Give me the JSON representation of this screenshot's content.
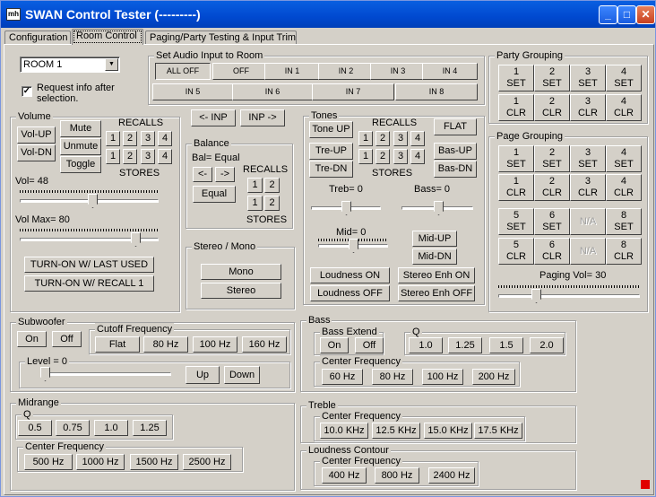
{
  "window": {
    "title": "SWAN Control Tester (---------)",
    "icon": "mh",
    "min": "_",
    "max": "□",
    "close": "✕"
  },
  "tabs": [
    "Configuration",
    "Room Control",
    "Paging/Party Testing & Input Trim"
  ],
  "room": {
    "selected": "ROOM 1",
    "request_info": "Request info after\nselection.",
    "checked": "✓"
  },
  "audio_input": {
    "title": "Set Audio Input to Room",
    "row1": [
      "ALL OFF",
      "OFF",
      "IN 1",
      "IN 2",
      "IN 3",
      "IN 4"
    ],
    "row2": [
      "IN 5",
      "IN 6",
      "IN 7",
      "IN 8"
    ]
  },
  "volume": {
    "title": "Volume",
    "vol_up": "Vol-UP",
    "vol_dn": "Vol-DN",
    "mute": "Mute",
    "unmute": "Unmute",
    "toggle": "Toggle",
    "recalls": "RECALLS",
    "stores": "STORES",
    "r1": [
      "1",
      "2",
      "3",
      "4"
    ],
    "r2": [
      "1",
      "2",
      "3",
      "4"
    ],
    "vol_label": "Vol= 48",
    "vol_value": 48,
    "volmax_label": "Vol Max= 80",
    "volmax_value": 80,
    "turn_on_last": "TURN-ON W/ LAST USED",
    "turn_on_recall": "TURN-ON W/ RECALL 1"
  },
  "inp": {
    "prev": "<- INP",
    "next": "INP ->"
  },
  "balance": {
    "title": "Balance",
    "status": "Bal= Equal",
    "left": "<-",
    "right": "->",
    "equal": "Equal",
    "recalls": "RECALLS",
    "stores": "STORES",
    "r1": [
      "1",
      "2"
    ],
    "r2": [
      "1",
      "2"
    ]
  },
  "stereo_mono": {
    "title": "Stereo / Mono",
    "mono": "Mono",
    "stereo": "Stereo"
  },
  "tones": {
    "title": "Tones",
    "tone_up": "Tone UP",
    "recalls": "RECALLS",
    "flat": "FLAT",
    "tre_up": "Tre-UP",
    "tre_dn": "Tre-DN",
    "bas_up": "Bas-UP",
    "bas_dn": "Bas-DN",
    "r1": [
      "1",
      "2",
      "3",
      "4"
    ],
    "r2": [
      "1",
      "2",
      "3",
      "4"
    ],
    "stores": "STORES",
    "treb_label": "Treb= 0",
    "bass_label": "Bass= 0",
    "mid_label": "Mid= 0",
    "mid_up": "Mid-UP",
    "mid_dn": "Mid-DN",
    "loud_on": "Loudness ON",
    "loud_off": "Loudness OFF",
    "senh_on": "Stereo Enh ON",
    "senh_off": "Stereo Enh OFF"
  },
  "party": {
    "title": "Party Grouping",
    "set": [
      "1\nSET",
      "2\nSET",
      "3\nSET",
      "4\nSET"
    ],
    "clr": [
      "1\nCLR",
      "2\nCLR",
      "3\nCLR",
      "4\nCLR"
    ]
  },
  "page": {
    "title": "Page Grouping",
    "set1": [
      "1\nSET",
      "2\nSET",
      "3\nSET",
      "4\nSET"
    ],
    "clr1": [
      "1\nCLR",
      "2\nCLR",
      "3\nCLR",
      "4\nCLR"
    ],
    "set2": [
      "5\nSET",
      "6\nSET",
      "N/A",
      "8\nSET"
    ],
    "clr2": [
      "5\nCLR",
      "6\nCLR",
      "N/A",
      "8\nCLR"
    ],
    "vol_label": "Paging Vol= 30",
    "vol_value": 30
  },
  "subwoofer": {
    "title": "Subwoofer",
    "on": "On",
    "off": "Off",
    "cutoff_title": "Cutoff Frequency",
    "cutoff": [
      "Flat",
      "80 Hz",
      "100 Hz",
      "160 Hz"
    ],
    "level_title": "Level = 0",
    "up": "Up",
    "down": "Down"
  },
  "midrange": {
    "title": "Midrange",
    "q_title": "Q",
    "q": [
      "0.5",
      "0.75",
      "1.0",
      "1.25"
    ],
    "cf_title": "Center Frequency",
    "cf": [
      "500 Hz",
      "1000 Hz",
      "1500 Hz",
      "2500 Hz"
    ]
  },
  "bass": {
    "title": "Bass",
    "extend_title": "Bass Extend",
    "on": "On",
    "off": "Off",
    "q_title": "Q",
    "q": [
      "1.0",
      "1.25",
      "1.5",
      "2.0"
    ],
    "cf_title": "Center Frequency",
    "cf": [
      "60 Hz",
      "80 Hz",
      "100 Hz",
      "200 Hz"
    ]
  },
  "treble": {
    "title": "Treble",
    "cf_title": "Center Frequency",
    "cf": [
      "10.0 KHz",
      "12.5 KHz",
      "15.0 KHz",
      "17.5 KHz"
    ]
  },
  "loudness": {
    "title": "Loudness Contour",
    "cf_title": "Center Frequency",
    "cf": [
      "400 Hz",
      "800 Hz",
      "2400 Hz"
    ]
  }
}
